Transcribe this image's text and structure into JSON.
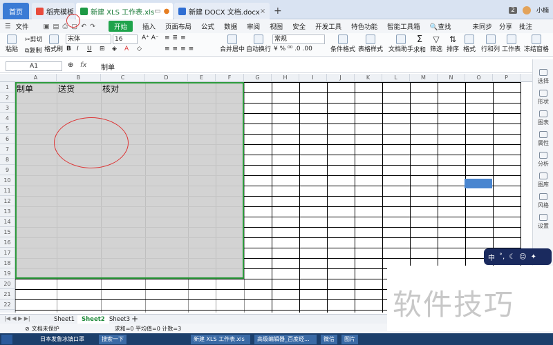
{
  "tabs": {
    "home": "首页",
    "doc_template": "稻壳模板",
    "xls": "新建 XLS 工作表.xls",
    "docx": "新建 DOCX 文档.docx",
    "count_badge": "2",
    "user": "小楠"
  },
  "menu": {
    "file": "文件",
    "start": "开始",
    "items": [
      "插入",
      "页面布局",
      "公式",
      "数据",
      "审阅",
      "视图",
      "安全",
      "开发工具",
      "特色功能",
      "智能工具箱"
    ],
    "search": "查找",
    "sync": "未同步",
    "share": "分享",
    "comment": "批注"
  },
  "ribbon": {
    "paste": "粘贴",
    "cut": "剪切",
    "copy": "复制",
    "format_painter": "格式刷",
    "font": "宋体",
    "font_size": "16",
    "merge": "合并居中",
    "wrap": "自动换行",
    "number_format": "常规",
    "cond_format": "条件格式",
    "table_style": "表格样式",
    "doc_helper": "文档助手",
    "sum": "求和",
    "filter": "筛选",
    "sort": "排序",
    "format": "格式",
    "rows_cols": "行和列",
    "worksheet": "工作表",
    "freeze": "冻结窗格"
  },
  "formula_bar": {
    "name_box": "A1",
    "fx": "fx",
    "content": "制单"
  },
  "columns": [
    "A",
    "B",
    "C",
    "D",
    "E",
    "F",
    "G",
    "H",
    "I",
    "J",
    "K",
    "L",
    "M",
    "N",
    "O",
    "P"
  ],
  "rows": [
    "1",
    "2",
    "3",
    "4",
    "5",
    "6",
    "7",
    "8",
    "9",
    "10",
    "11",
    "12",
    "13",
    "14",
    "15",
    "16",
    "17",
    "18",
    "19",
    "20",
    "21",
    "22"
  ],
  "cells": {
    "a1": "制单",
    "b1": "送货",
    "c1": "核对"
  },
  "sheets": [
    "Sheet1",
    "Sheet2",
    "Sheet3"
  ],
  "active_sheet": "Sheet2",
  "status": {
    "protect": "文档未保护",
    "calc": "求和=0  平均值=0  计数=3"
  },
  "sidebar": [
    "选择",
    "形状",
    "图表",
    "属性",
    "分析",
    "图库",
    "风格",
    "设置"
  ],
  "ime": {
    "lang": "中"
  },
  "taskbar": [
    "日本发鲁冰镇口罩",
    "搜索一下",
    "新建 XLS 工作表.xls",
    "高级编辑器_百度经...",
    "微信",
    "图片"
  ],
  "watermark": "软件技巧"
}
